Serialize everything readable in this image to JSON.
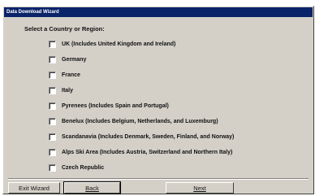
{
  "window": {
    "title": "Data Download Wizard"
  },
  "heading": "Select a Country or Region:",
  "options": [
    {
      "label": "UK (Includes United Kingdom and Ireland)",
      "checked": false
    },
    {
      "label": "Germany",
      "checked": false
    },
    {
      "label": "France",
      "checked": false
    },
    {
      "label": "Italy",
      "checked": false
    },
    {
      "label": "Pyrenees (Includes Spain and Portugal)",
      "checked": false
    },
    {
      "label": "Benelux (Includes Belgium, Netherlands, and Luxemburg)",
      "checked": false
    },
    {
      "label": "Scandanavia (Includes Denmark, Sweden, Finland, and Norway)",
      "checked": false
    },
    {
      "label": "Alps Ski Area (Includes Austria, Switzerland and Northern Italy)",
      "checked": false
    },
    {
      "label": "Czech Republic",
      "checked": false
    }
  ],
  "buttons": {
    "exit": "Exit Wizard",
    "back": "Back",
    "next": "Next"
  }
}
